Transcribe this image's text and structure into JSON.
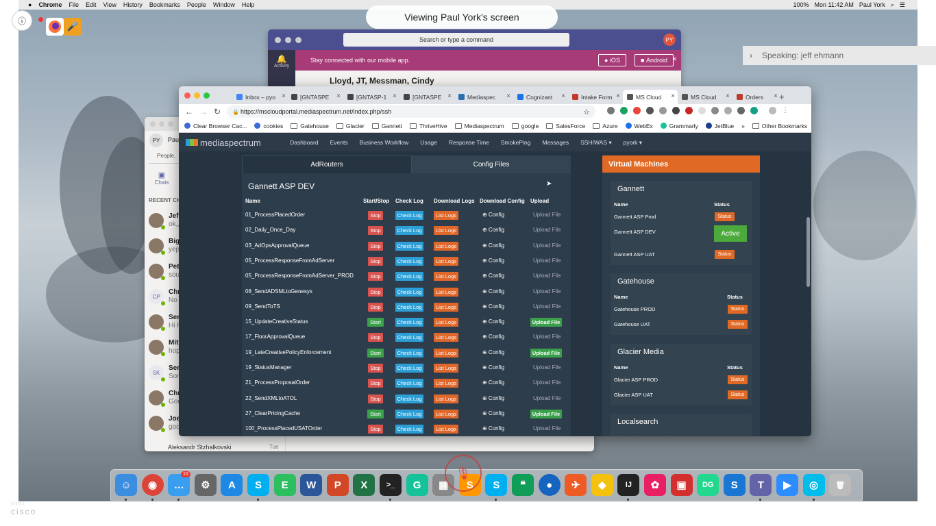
{
  "overlay": {
    "viewing_label": "Viewing Paul York's screen",
    "speaking_label": "Speaking: jeff ehmann",
    "info_glyph": "ⓘ",
    "brand": "cisco"
  },
  "menubar": {
    "app": "Chrome",
    "items": [
      "File",
      "Edit",
      "View",
      "History",
      "Bookmarks",
      "People",
      "Window",
      "Help"
    ],
    "battery": "100%",
    "clock": "Mon 11:42 AM",
    "user": "Paul York"
  },
  "teams_top": {
    "search_placeholder": "Search or type a command",
    "avatar_initials": "PY",
    "banner": "Stay connected with our mobile app.",
    "ios": "iOS",
    "android": "Android",
    "rail_label": "Activity",
    "chat_names": "Lloyd, JT, Messman, Cindy"
  },
  "teams_chats": {
    "self_initials": "PY",
    "self_name": "Paul",
    "people_search": "People,",
    "chats_label": "Chats",
    "recent": "RECENT CHA",
    "rows": [
      {
        "name": "Jeff",
        "preview": "ok,,",
        "initials": ""
      },
      {
        "name": "Big",
        "preview": "yep",
        "initials": ""
      },
      {
        "name": "Pet",
        "preview": "sou",
        "initials": ""
      },
      {
        "name": "Chr",
        "preview": "No",
        "initials": "CP"
      },
      {
        "name": "Ser",
        "preview": "Hi F",
        "initials": ""
      },
      {
        "name": "Mit",
        "preview": "hop",
        "initials": ""
      },
      {
        "name": "Ser",
        "preview": "Sor",
        "initials": "SK"
      },
      {
        "name": "Chr",
        "preview": "Goo",
        "initials": ""
      },
      {
        "name": "Joe",
        "preview": "goo",
        "initials": ""
      }
    ],
    "bottom_name": "Aleksandr Stzhalkovski",
    "bottom_date": "Tue"
  },
  "browser": {
    "tabs": [
      {
        "label": "Inbox – pyo",
        "color": "#4285f4"
      },
      {
        "label": "[GNTASPE",
        "color": "#444"
      },
      {
        "label": "[GNTASP-1",
        "color": "#444"
      },
      {
        "label": "[GNTASPE",
        "color": "#444"
      },
      {
        "label": "Mediaspec",
        "color": "#2a6fb0"
      },
      {
        "label": "Cognizant",
        "color": "#1a73e8"
      },
      {
        "label": "Intake Form",
        "color": "#c0392b"
      },
      {
        "label": "MS Cloud",
        "color": "#555"
      },
      {
        "label": "MS Cloud",
        "color": "#555"
      },
      {
        "label": "Orders",
        "color": "#c0392b"
      }
    ],
    "new_tab": "+",
    "url": "https://mscloudportal.mediaspectrum.net/index.php/ssh",
    "bookmarks": [
      "Clear Browser Cac...",
      "cookies",
      "Gatehouse",
      "Glacier",
      "Gannett",
      "ThriveHive",
      "Mediaspectrum",
      "google",
      "SalesForce",
      "Azure",
      "WebEx",
      "Grammarly",
      "JetBlue"
    ],
    "more_bookmarks": "»",
    "other_bookmarks": "Other Bookmarks"
  },
  "app": {
    "logo": "mediaspectrum",
    "nav": [
      "Dashboard",
      "Events",
      "Business Workflow",
      "Usage",
      "Response Time",
      "SmokePing",
      "Messages",
      "SSH/WAS ▾",
      "pyork ▾"
    ],
    "tab_adrouters": "AdRouters",
    "tab_config": "Config Files",
    "panel_title": "Gannett ASP DEV",
    "headers": {
      "name": "Name",
      "startstop": "Start/Stop",
      "checklog": "Check Log",
      "downloadlogs": "Download Logs",
      "downloadconfig": "Download Config",
      "upload": "Upload"
    },
    "rows": [
      {
        "name": "01_ProcessPlacedOrder",
        "action": "Stop",
        "upload": "Upload File",
        "upload_active": false
      },
      {
        "name": "02_Daily_Once_Day",
        "action": "Stop",
        "upload": "Upload File",
        "upload_active": false
      },
      {
        "name": "03_AdOpsApprovalQueue",
        "action": "Stop",
        "upload": "Upload File",
        "upload_active": false
      },
      {
        "name": "05_ProcessResponseFromAdServer",
        "action": "Stop",
        "upload": "Upload File",
        "upload_active": false
      },
      {
        "name": "05_ProcessResponseFromAdServer_PROD",
        "action": "Stop",
        "upload": "Upload File",
        "upload_active": false
      },
      {
        "name": "08_SendADSMLtoGenesys",
        "action": "Stop",
        "upload": "Upload File",
        "upload_active": false
      },
      {
        "name": "09_SendToTS",
        "action": "Stop",
        "upload": "Upload File",
        "upload_active": false
      },
      {
        "name": "15_UpdateCreativeStatus",
        "action": "Start",
        "upload": "Upload File",
        "upload_active": true
      },
      {
        "name": "17_FloorApprovalQueue",
        "action": "Stop",
        "upload": "Upload File",
        "upload_active": false
      },
      {
        "name": "19_LateCreativePolicyEnforcement",
        "action": "Start",
        "upload": "Upload File",
        "upload_active": true
      },
      {
        "name": "19_StatusManager",
        "action": "Stop",
        "upload": "Upload File",
        "upload_active": false
      },
      {
        "name": "21_ProcessProposalOrder",
        "action": "Stop",
        "upload": "Upload File",
        "upload_active": false
      },
      {
        "name": "22_SendXMLtoATOL",
        "action": "Stop",
        "upload": "Upload File",
        "upload_active": false
      },
      {
        "name": "27_ClearPricingCache",
        "action": "Start",
        "upload": "Upload File",
        "upload_active": true
      },
      {
        "name": "100_ProcessPlacedUSATOrder",
        "action": "Stop",
        "upload": "Upload File",
        "upload_active": false
      }
    ],
    "check_log": "Check Log",
    "list_logs": "List Logs",
    "config": "⊕ Config",
    "vm_title": "Virtual Machines",
    "vm_name_header": "Name",
    "vm_status_header": "Status",
    "status_label": "Status",
    "active_label": "Active",
    "vm_groups": [
      {
        "title": "Gannett",
        "items": [
          "Gannett ASP Prod",
          "Gannett ASP DEV",
          "Gannett ASP UAT"
        ]
      },
      {
        "title": "Gatehouse",
        "items": [
          "Gatehouse PROD",
          "Gatehouse UAT"
        ]
      },
      {
        "title": "Glacier Media",
        "items": [
          "Glacier ASP PROD",
          "Glacier ASP UAT"
        ]
      },
      {
        "title": "Localsearch",
        "items": []
      }
    ]
  },
  "dock": {
    "badge": "10",
    "apps": [
      {
        "name": "finder-icon",
        "glyph": "☺",
        "color": "#3b8de0"
      },
      {
        "name": "chrome-icon",
        "glyph": "◉",
        "color": "#db4437"
      },
      {
        "name": "messages-icon",
        "glyph": "…",
        "color": "#3a9ef0"
      },
      {
        "name": "system-preferences-icon",
        "glyph": "⚙",
        "color": "#666"
      },
      {
        "name": "app-store-icon",
        "glyph": "A",
        "color": "#1e88e5"
      },
      {
        "name": "skype-icon",
        "glyph": "S",
        "color": "#00aff0"
      },
      {
        "name": "evernote-icon",
        "glyph": "E",
        "color": "#2dbe60"
      },
      {
        "name": "word-icon",
        "glyph": "W",
        "color": "#2b579a"
      },
      {
        "name": "powerpoint-icon",
        "glyph": "P",
        "color": "#d24726"
      },
      {
        "name": "excel-icon",
        "glyph": "X",
        "color": "#217346"
      },
      {
        "name": "terminal-icon",
        "glyph": ">_",
        "color": "#222"
      },
      {
        "name": "grammarly-icon",
        "glyph": "G",
        "color": "#15c39a"
      },
      {
        "name": "launchpad-icon",
        "glyph": "▦",
        "color": "#888"
      },
      {
        "name": "sublime-icon",
        "glyph": "S",
        "color": "#ff9800"
      },
      {
        "name": "skype-business-icon",
        "glyph": "S",
        "color": "#00aff0"
      },
      {
        "name": "hangouts-icon",
        "glyph": "❝",
        "color": "#0f9d58"
      },
      {
        "name": "globe-icon",
        "glyph": "●",
        "color": "#1565c0"
      },
      {
        "name": "postman-icon",
        "glyph": "✈",
        "color": "#ef5b25"
      },
      {
        "name": "cyberduck-icon",
        "glyph": "◆",
        "color": "#f4c20d"
      },
      {
        "name": "intellij-icon",
        "glyph": "IJ",
        "color": "#222"
      },
      {
        "name": "photos-icon",
        "glyph": "✿",
        "color": "#e91e63"
      },
      {
        "name": "remote-desktop-icon",
        "glyph": "▣",
        "color": "#d32f2f"
      },
      {
        "name": "datagrip-icon",
        "glyph": "DG",
        "color": "#22d88f"
      },
      {
        "name": "sqldeveloper-icon",
        "glyph": "S",
        "color": "#1976d2"
      },
      {
        "name": "teams-icon",
        "glyph": "T",
        "color": "#6264a7"
      },
      {
        "name": "zoom-icon",
        "glyph": "▶",
        "color": "#2d8cff"
      },
      {
        "name": "webex-meetings-icon",
        "glyph": "◎",
        "color": "#00bceb"
      },
      {
        "name": "trash-icon",
        "glyph": "🗑",
        "color": "#bbb"
      }
    ]
  }
}
